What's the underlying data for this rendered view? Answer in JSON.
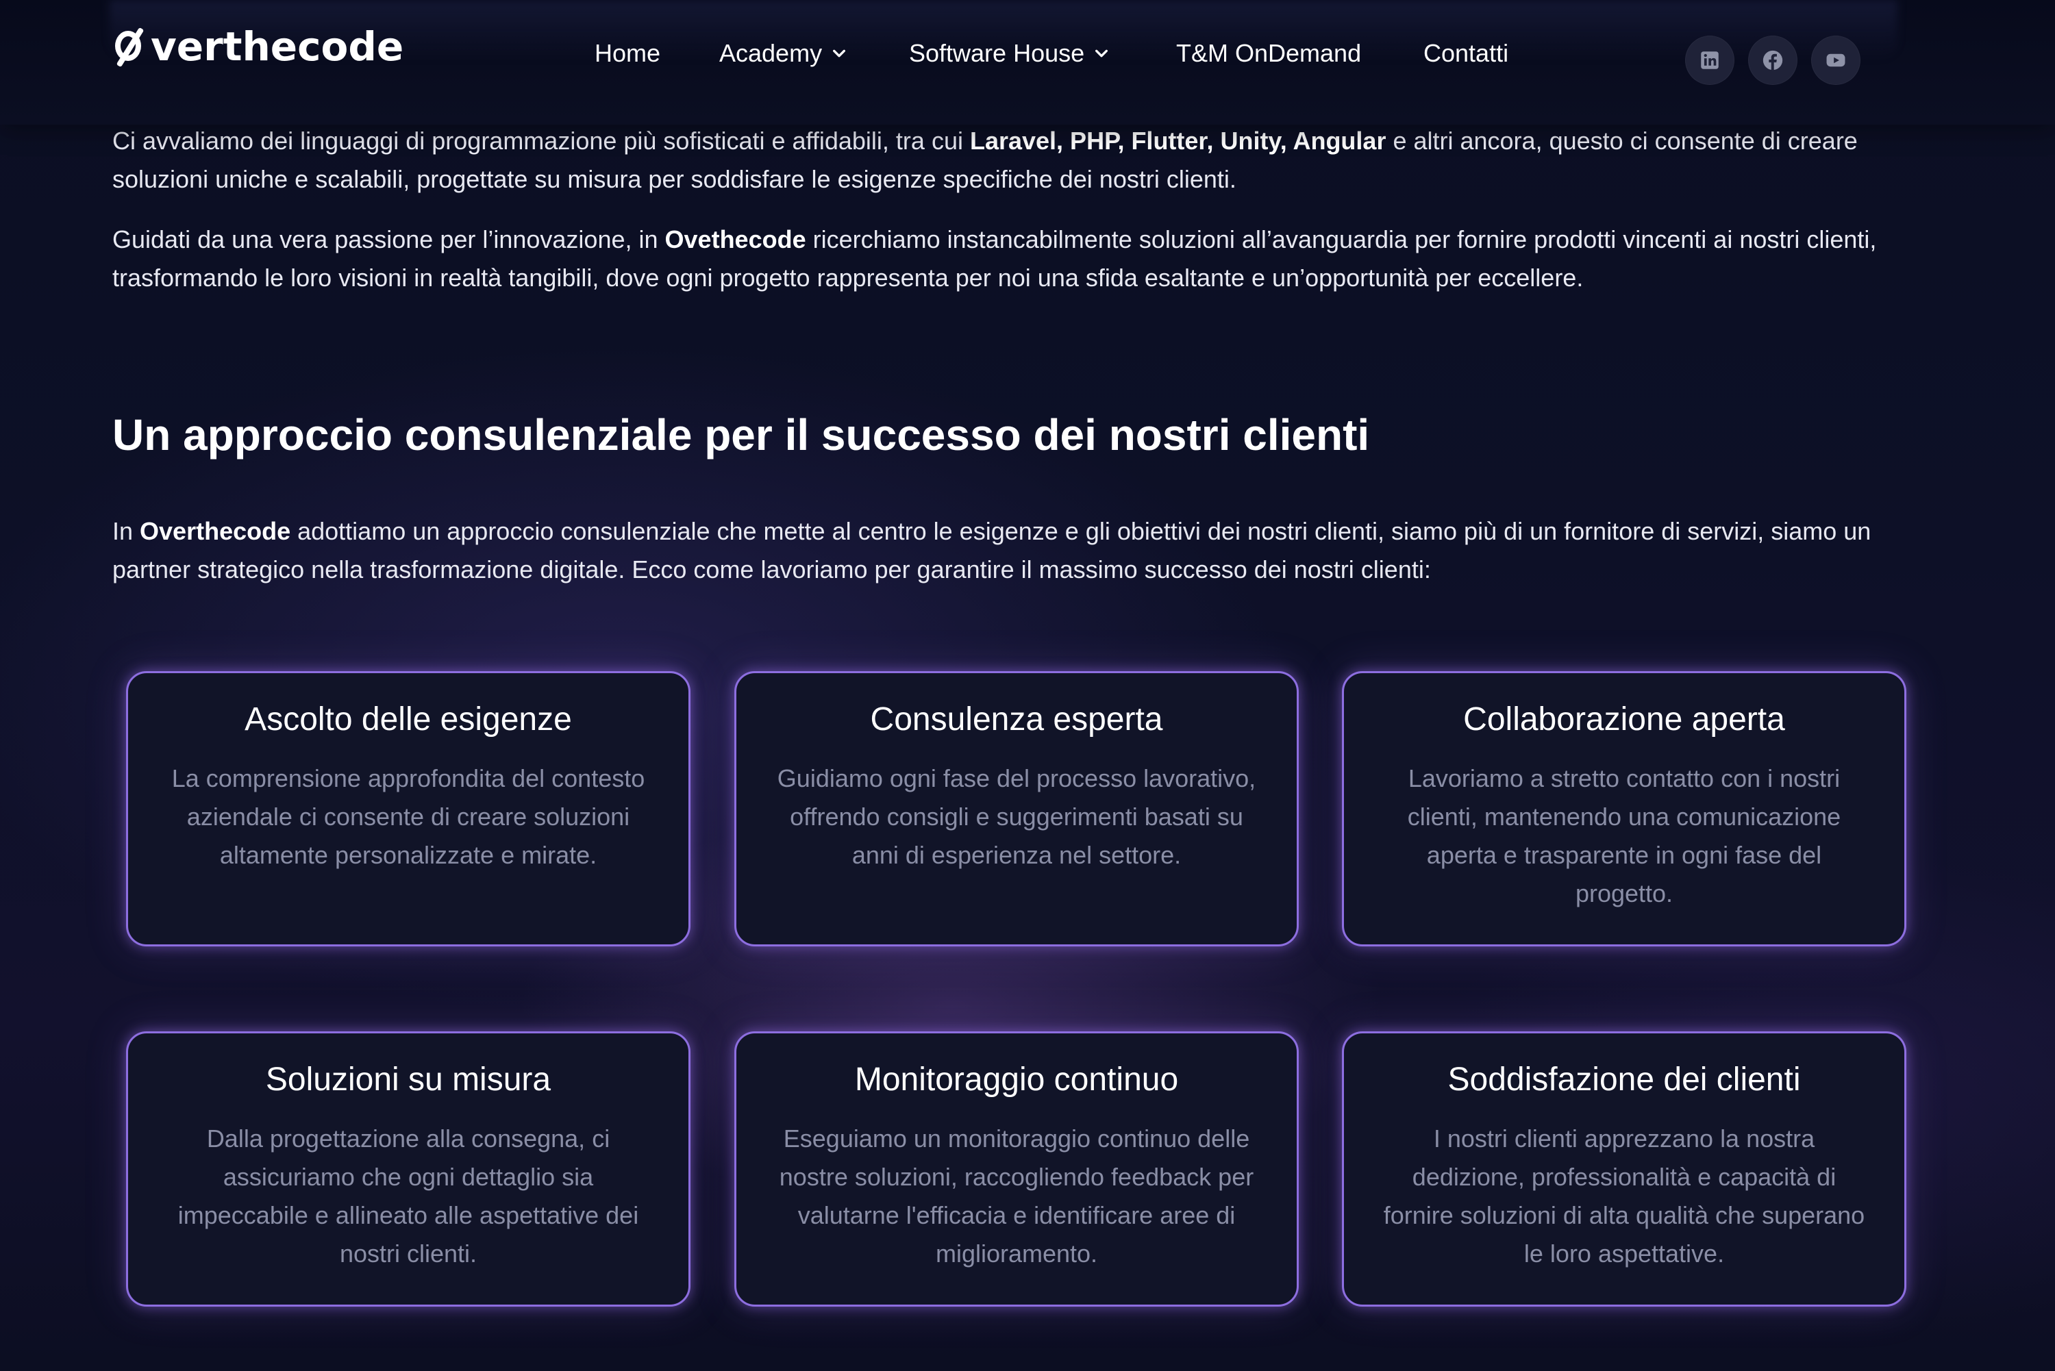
{
  "header": {
    "logo_text": "verthecode",
    "logo_alt": "Overthecode",
    "nav": {
      "home": "Home",
      "academy": "Academy",
      "software_house": "Software House",
      "tm_ondemand": "T&M OnDemand",
      "contatti": "Contatti"
    },
    "social": [
      "linkedin-icon",
      "facebook-icon",
      "youtube-icon"
    ]
  },
  "content": {
    "para1": {
      "part1": "Ci avvaliamo dei linguaggi di programmazione più sofisticati e affidabili, tra cui ",
      "bold": "Laravel, PHP, Flutter, Unity, Angular",
      "part2": " e altri ancora, questo ci consente di creare soluzioni uniche e scalabili, progettate su misura per soddisfare le esigenze specifiche dei nostri clienti."
    },
    "para2": {
      "part1": "Guidati da una vera passione per l’innovazione, in ",
      "bold": "Ovethecode",
      "part2": " ricerchiamo instancabilmente soluzioni all’avanguardia per fornire prodotti vincenti ai nostri clienti, trasformando le loro visioni in realtà tangibili, dove ogni progetto rappresenta per noi una sfida esaltante e un’opportunità per eccellere."
    },
    "section_title": "Un approccio consulenziale per il successo dei nostri clienti",
    "para3": {
      "part1": "In ",
      "bold": "Overthecode",
      "part2": " adottiamo un approccio consulenziale che mette al centro le esigenze e gli obiettivi dei nostri clienti, siamo più di un fornitore di servizi, siamo un  partner strategico nella trasformazione digitale. Ecco come lavoriamo per garantire il massimo successo dei nostri clienti:"
    }
  },
  "cards": [
    {
      "title": "Ascolto delle esigenze",
      "text": "La comprensione approfondita del contesto aziendale ci consente di creare soluzioni altamente personalizzate e mirate."
    },
    {
      "title": "Consulenza esperta",
      "text": "Guidiamo ogni fase del processo lavorativo, offrendo consigli e suggerimenti basati su anni di esperienza nel settore."
    },
    {
      "title": "Collaborazione aperta",
      "text": "Lavoriamo a stretto contatto con i nostri clienti, mantenendo una comunicazione aperta e trasparente in ogni fase del progetto."
    },
    {
      "title": "Soluzioni su misura",
      "text": "Dalla progettazione alla consegna, ci assicuriamo che ogni dettaglio sia impeccabile e allineato alle aspettative dei nostri clienti."
    },
    {
      "title": "Monitoraggio continuo",
      "text": "Eseguiamo un monitoraggio continuo delle nostre soluzioni, raccogliendo feedback per valutarne l'efficacia e identificare aree di miglioramento."
    },
    {
      "title": "Soddisfazione dei clienti",
      "text": "I nostri clienti apprezzano la nostra dedizione, professionalità e capacità di fornire soluzioni di alta qualità che superano le loro aspettative."
    }
  ],
  "colors": {
    "background": "#0d1027",
    "card_border": "#8d6ee0",
    "card_background": "#111428",
    "card_text": "#8a8ea6",
    "body_text": "#e8e9f2"
  }
}
